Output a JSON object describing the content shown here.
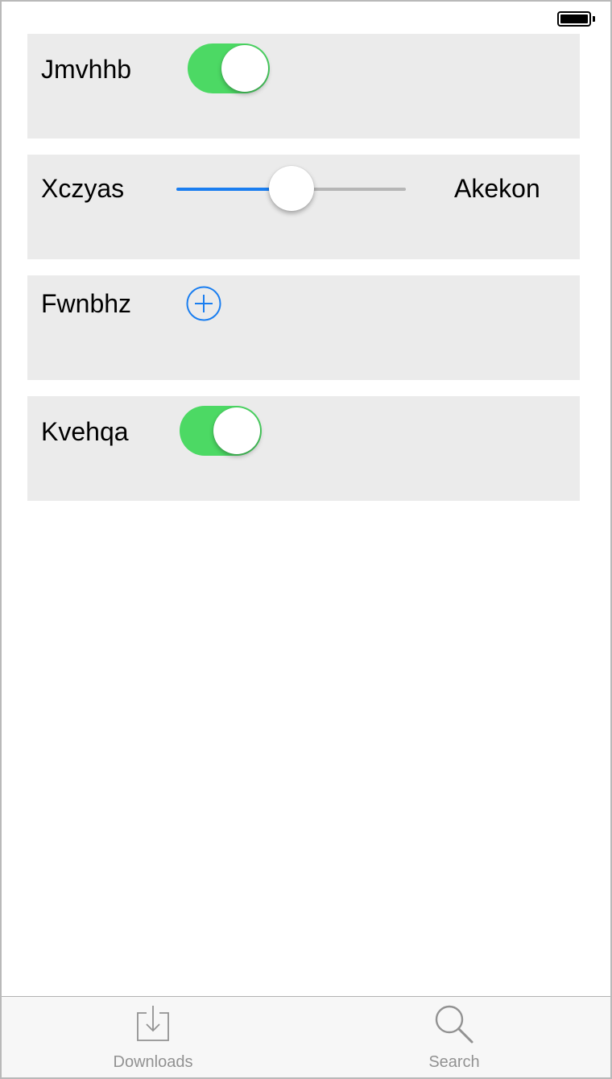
{
  "status_bar": {
    "battery_icon": "battery-full-icon",
    "battery_level": 1.0
  },
  "rows": [
    {
      "label": "Jmvhhb",
      "control": "switch",
      "on": true
    },
    {
      "label": "Xczyas",
      "control": "slider",
      "value_label": "Akekon",
      "slider_fraction": 0.5
    },
    {
      "label": "Fwnbhz",
      "control": "add-button",
      "icon": "plus-circle-icon"
    },
    {
      "label": "Kvehqa",
      "control": "switch",
      "on": true
    }
  ],
  "tab_bar": {
    "items": [
      {
        "label": "Downloads",
        "icon": "downloads-icon"
      },
      {
        "label": "Search",
        "icon": "search-icon"
      }
    ]
  },
  "colors": {
    "switch_on": "#4cd964",
    "tint_blue": "#1a7ef0",
    "row_background": "#ebebeb",
    "tab_inactive": "#929292"
  }
}
